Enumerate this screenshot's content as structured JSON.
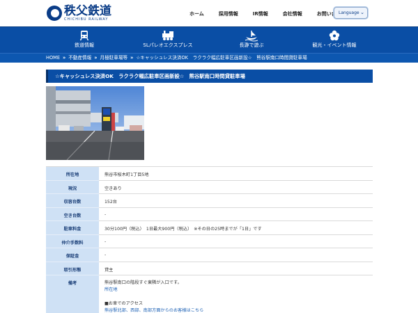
{
  "header": {
    "logo_jp": "秩父鉄道",
    "logo_en": "CHICHIBU RAILWAY",
    "nav": [
      "ホーム",
      "採用情報",
      "IR情報",
      "会社情報",
      "お問い合わせ"
    ],
    "language_label": "Language"
  },
  "main_nav": [
    {
      "label": "鉄道情報",
      "icon": "train-icon"
    },
    {
      "label": "SLパレオエクスプレス",
      "icon": "steam-locomotive-icon"
    },
    {
      "label": "長瀞で遊ぶ",
      "icon": "boat-icon"
    },
    {
      "label": "観光・イベント情報",
      "icon": "flower-icon"
    }
  ],
  "breadcrumb": [
    "HOME",
    "不動産情報",
    "月極駐車場等",
    "☆キャッシュレス決済OK　ラクラク幅広駐車区画新設☆　熊谷駅南口時間貸駐車場"
  ],
  "page_title": "☆キャッシュレス決済OK　ラクラク幅広駐車区画新設☆　熊谷駅南口時間貸駐車場",
  "details": {
    "rows": [
      {
        "key": "所在地",
        "value": "熊谷市桜木町1丁目5地"
      },
      {
        "key": "現況",
        "value": "空きあり"
      },
      {
        "key": "収容台数",
        "value": "152台"
      },
      {
        "key": "空き台数",
        "value": "-"
      },
      {
        "key": "駐車料金",
        "value": "30分100円（税込）　1日最大900円（税込）　※その日の25時までが「1日」です"
      },
      {
        "key": "仲介手数料",
        "value": "-"
      },
      {
        "key": "保証金",
        "value": "-"
      },
      {
        "key": "取引形態",
        "value": "貸主"
      }
    ],
    "remarks_key": "備考",
    "remarks_line1": "熊谷駅南口の階段すぐ東隣が入口です。",
    "remarks_link1": "所在地",
    "remarks_line2": "■お車でのアクセス",
    "remarks_link2": "熊谷駅北部、西部、南部方面からのお客様はこちら"
  },
  "colors": {
    "brand_blue": "#0a4ea5",
    "label_cell": "#cfe1f5",
    "link": "#1a5fb4"
  }
}
